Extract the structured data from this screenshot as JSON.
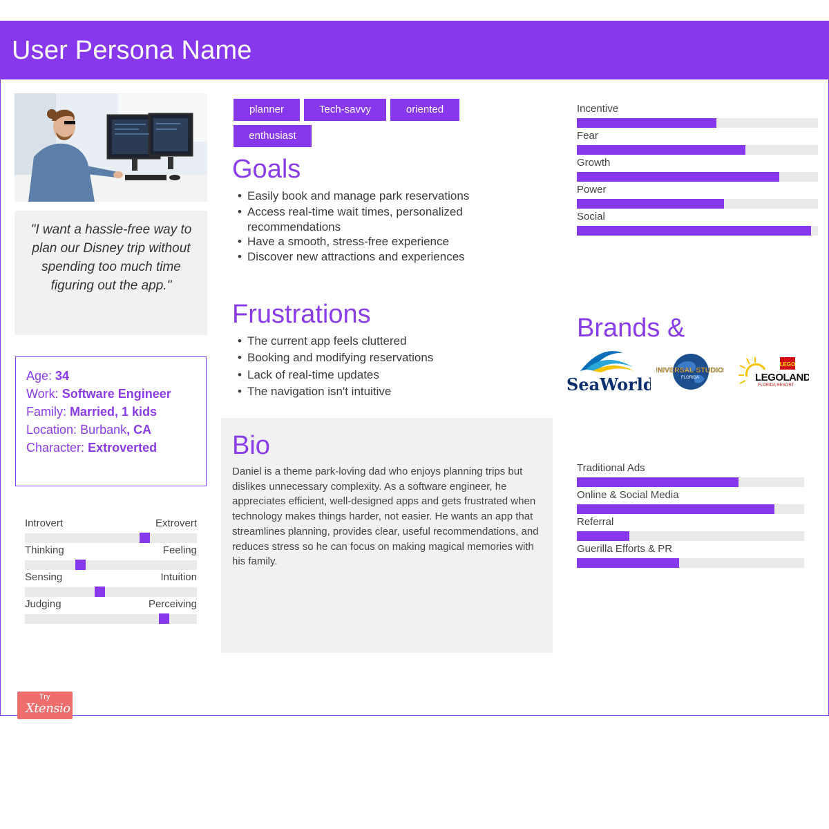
{
  "header": {
    "title": "User Persona Name"
  },
  "quote": "\"I want a hassle-free way to plan our Disney trip without spending too much time figuring out the app.\"",
  "info": {
    "age_label": "Age:",
    "age_value": "34",
    "work_label": "Work:",
    "work_value": "Software Engineer",
    "family_label": "Family:",
    "family_value": "Married, 1 kids",
    "location_label": "Location:",
    "location_city": "Burbank",
    "location_state": ", CA",
    "character_label": "Character:",
    "character_value": "Extroverted"
  },
  "personality": [
    {
      "left": "Introvert",
      "right": "Extrovert",
      "level": 0.71
    },
    {
      "left": "Thinking",
      "right": "Feeling",
      "level": 0.31
    },
    {
      "left": "Sensing",
      "right": "Intuition",
      "level": 0.43
    },
    {
      "left": "Judging",
      "right": "Perceiving",
      "level": 0.83
    }
  ],
  "tags": [
    "planner",
    "Tech-savvy",
    "oriented",
    "enthusiast"
  ],
  "goals": {
    "heading": "Goals",
    "items": [
      " Easily book and manage park reservations",
      "Access real-time wait times, personalized",
      "recommendations",
      "Have a smooth, stress-free experience",
      "Discover new attractions and experiences"
    ]
  },
  "frustrations": {
    "heading": "Frustrations",
    "items": [
      "The current app feels cluttered",
      "Booking and modifying reservations",
      "Lack of real-time updates",
      "The navigation isn't intuitive"
    ]
  },
  "bio": {
    "heading": "Bio",
    "text": "Daniel is a theme park-loving dad who enjoys planning trips but dislikes unnecessary complexity. As a software engineer, he appreciates efficient, well-designed apps and gets frustrated when technology makes things harder, not easier. He wants an app that streamlines planning, provides clear, useful recommendations, and reduces stress so he can focus on making magical memories with his family."
  },
  "motivations": [
    {
      "label": "Incentive",
      "level": 0.58
    },
    {
      "label": "Fear",
      "level": 0.7
    },
    {
      "label": "Growth",
      "level": 0.84
    },
    {
      "label": "Power",
      "level": 0.61
    },
    {
      "label": "Social",
      "level": 0.97
    }
  ],
  "brands": {
    "heading": "Brands &",
    "logos": {
      "seaworld": "SeaWorld",
      "universal_top": "UNIVERSAL STUDIOS",
      "universal_bottom": "FLORIDA",
      "lego_badge": "LEGO",
      "legoland": "LEGOLAND",
      "legoland_sub": "FLORIDA RESORT"
    }
  },
  "channels": [
    {
      "label": "Traditional Ads",
      "level": 0.71
    },
    {
      "label": "Online & Social Media",
      "level": 0.87
    },
    {
      "label": "Referral",
      "level": 0.23
    },
    {
      "label": "Guerilla Efforts & PR",
      "level": 0.45
    }
  ],
  "badge": {
    "small": "Try",
    "main": "Xtensio"
  },
  "colors": {
    "accent": "#8738ec",
    "track": "#eaeaea",
    "panel": "#f1f1f1",
    "badge": "#ee6e6e"
  }
}
